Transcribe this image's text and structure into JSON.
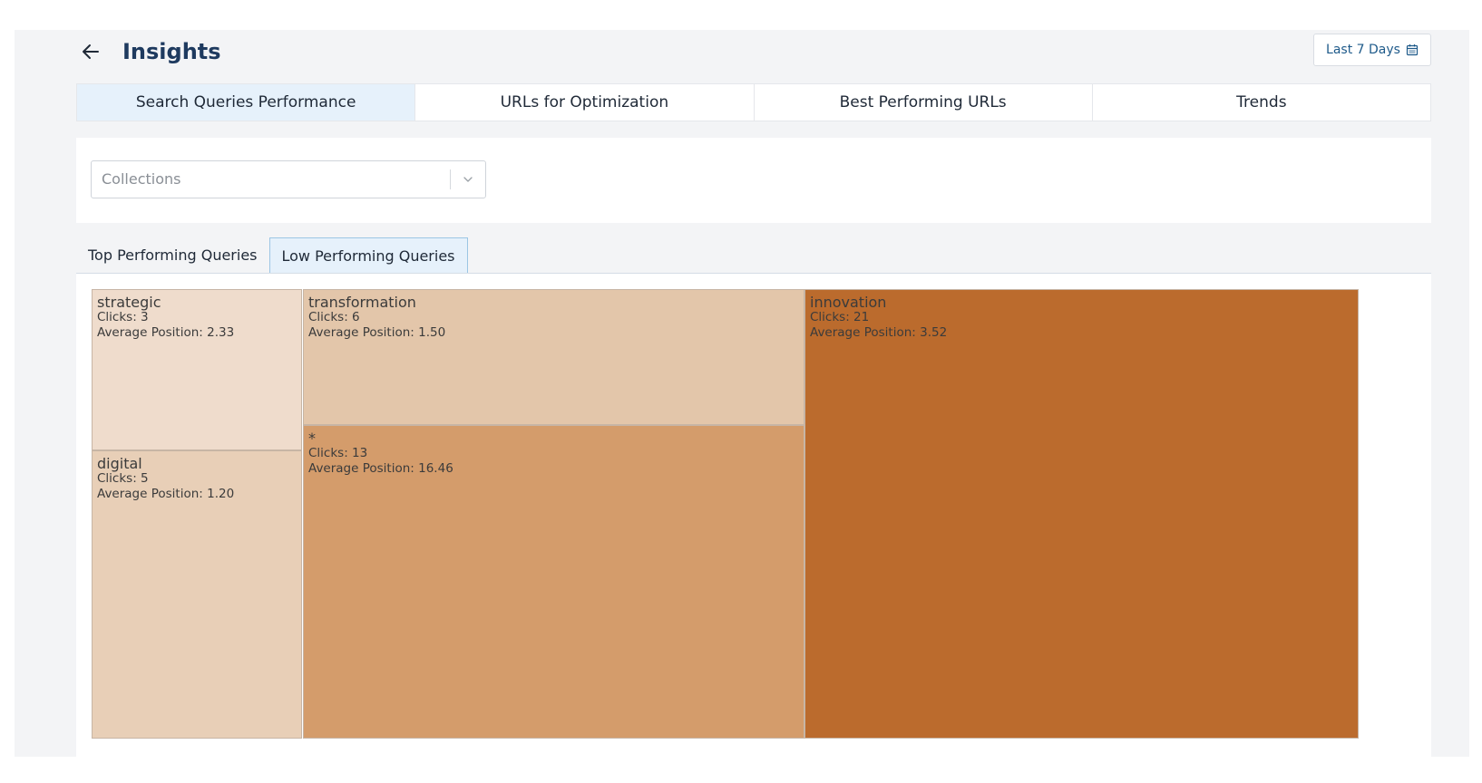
{
  "header": {
    "title": "Insights",
    "date_range_label": "Last 7 Days"
  },
  "tabs": [
    {
      "label": "Search Queries Performance",
      "active": true
    },
    {
      "label": "URLs for Optimization",
      "active": false
    },
    {
      "label": "Best Performing URLs",
      "active": false
    },
    {
      "label": "Trends",
      "active": false
    }
  ],
  "filters": {
    "collections_placeholder": "Collections"
  },
  "subtabs": [
    {
      "label": "Top Performing Queries",
      "active": false
    },
    {
      "label": "Low Performing Queries",
      "active": true
    }
  ],
  "chart_data": {
    "type": "treemap",
    "items": [
      {
        "name": "strategic",
        "clicks_text": "Clicks: 3",
        "avg_pos_text": "Average Position: 2.33",
        "clicks": 3,
        "average_position": 2.33,
        "color": "#efdccc"
      },
      {
        "name": "digital",
        "clicks_text": "Clicks: 5",
        "avg_pos_text": "Average Position: 1.20",
        "clicks": 5,
        "average_position": 1.2,
        "color": "#e8cfb7"
      },
      {
        "name": "transformation",
        "clicks_text": "Clicks: 6",
        "avg_pos_text": "Average Position: 1.50",
        "clicks": 6,
        "average_position": 1.5,
        "color": "#e3c6aa"
      },
      {
        "name": "*",
        "clicks_text": "Clicks: 13",
        "avg_pos_text": "Average Position: 16.46",
        "clicks": 13,
        "average_position": 16.46,
        "color": "#d49c6b"
      },
      {
        "name": "innovation",
        "clicks_text": "Clicks: 21",
        "avg_pos_text": "Average Position: 3.52",
        "clicks": 21,
        "average_position": 3.52,
        "color": "#bb6b2d"
      }
    ]
  }
}
